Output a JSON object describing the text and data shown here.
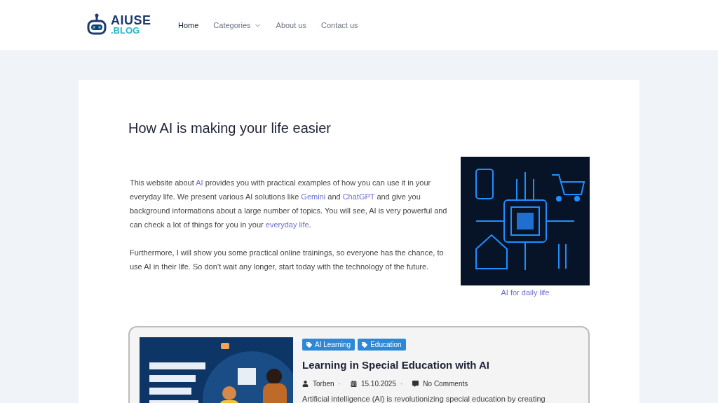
{
  "header": {
    "logo": {
      "name": "AIUSE",
      "suffix": ".BLOG"
    },
    "nav": [
      {
        "label": "Home",
        "selected": true,
        "dropdown": false
      },
      {
        "label": "Categories",
        "selected": false,
        "dropdown": true
      },
      {
        "label": "About us",
        "selected": false,
        "dropdown": false
      },
      {
        "label": "Contact us",
        "selected": false,
        "dropdown": false
      }
    ]
  },
  "main": {
    "title": "How AI is making your life easier",
    "paragraphs": [
      [
        {
          "text": "This website about "
        },
        {
          "text": "AI",
          "link": true
        },
        {
          "text": " provides you with practical examples of how you can use it in your everyday life. We present various AI solutions like "
        },
        {
          "text": "Gemini",
          "link": true
        },
        {
          "text": " and "
        },
        {
          "text": "ChatGPT",
          "link": true
        },
        {
          "text": " and give you background informations about a large number of topics. You will see, AI is very powerful and can check a lot of things for you in your "
        },
        {
          "text": "everyday life",
          "link": true
        },
        {
          "text": "."
        }
      ],
      [
        {
          "text": "Furthermore, I will show you some practical online trainings, so everyone has the chance, to use AI in their life. So don’t wait any longer, start today with the technology of the future."
        }
      ]
    ],
    "figure": {
      "kind": "picture",
      "caption": "AI for daily life"
    }
  },
  "post": {
    "tags": [
      "AI Learning",
      "Education"
    ],
    "title": "Learning in Special Education with AI",
    "separator": "·",
    "author": "Torben",
    "date": "15.10.2025",
    "comments": "No Comments",
    "excerpt": "Artificial intelligence (AI) is revolutionizing special education by creating"
  }
}
